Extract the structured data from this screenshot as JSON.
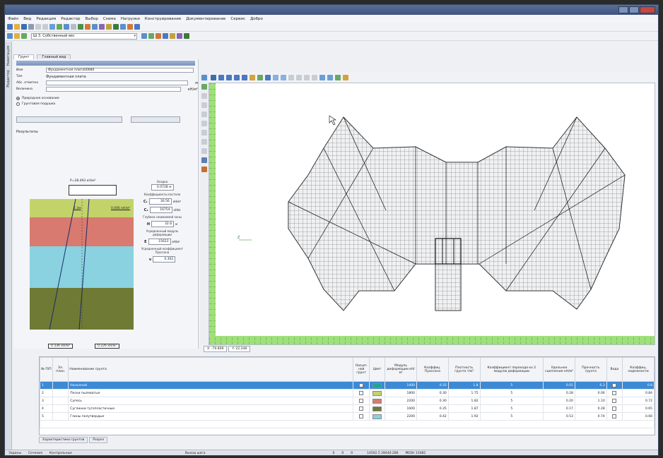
{
  "window": {
    "title": ""
  },
  "menu": [
    "Файл",
    "Вид",
    "Редакция",
    "Редактор",
    "Выбор",
    "Схема",
    "Нагрузки",
    "Конструирование",
    "Документирование",
    "Сервис",
    "Добро"
  ],
  "toolbar": {
    "combo_value": "Ш 3. Собственный вес"
  },
  "left_strip": [
    "Навигация",
    "Редактор"
  ],
  "tabs": [
    "Грунт",
    "Главный вид"
  ],
  "panel": {
    "header": "",
    "name_label": "Имя",
    "name_value": "Фундаментная плита00680",
    "type_label": "Тип",
    "type_value": "Фундаментная плита",
    "abs_label": "Абс. отметка",
    "abs_unit": "м",
    "area_label": "Величина",
    "area_unit": "кН/м²",
    "radio1": "Природное основание",
    "radio2": "Грунтовая подушка",
    "btn_calc": "",
    "btn_param": "",
    "results_label": "Результаты",
    "load_label": "P=28.493 кН/м²",
    "settle_label": "Осадка",
    "settle_value": "0.0728 м",
    "coef_label": "Коэффициенты постели",
    "c1_label": "C₁",
    "c1_value": "30.56",
    "c1_unit": "кН/м³",
    "c2_label": "C₂",
    "c2_value": "16754",
    "c2_unit": "кН/м",
    "depth_label": "Глубина сжимаемой зоны",
    "h_label": "H",
    "h_value": "32.6",
    "h_unit": "м",
    "mod_label": "Усредненный модуль деформации",
    "e_label": "E",
    "e_value": "15623",
    "e_unit": "кН/м²",
    "pois_label": "Усредненный коэффициент Пуассона",
    "v_label": "ν",
    "v_value": "0.302",
    "bottom_left": "0.336 кН/м²",
    "bottom_right": "0.226 кН/м²",
    "mid_left": "2.3м",
    "mid_right": "0.006 кН/м²",
    "soil_layers": [
      {
        "color": "#c3d36a",
        "h": 14
      },
      {
        "color": "#d87a6f",
        "h": 22
      },
      {
        "color": "#8ad2e0",
        "h": 32
      },
      {
        "color": "#6f7a35",
        "h": 32
      }
    ]
  },
  "canvas": {
    "axis_label": "Z"
  },
  "coords": {
    "x": "X: -70.809",
    "y": "Y: 22.248"
  },
  "grid": {
    "headers": [
      "№ П/П",
      "Эл. план.",
      "Наименование грунта",
      "Насып-ной грунт",
      "Цвет",
      "Модуль деформации кН/м²",
      "Коэффиц. Пуассона",
      "Плотность грунта т/м³",
      "Коэффициент перехода ко 2 модулю деформации",
      "Удельное сцепление кН/м²",
      "Прочность грунта",
      "Вода",
      "Коэффиц. надежности"
    ],
    "rows": [
      {
        "n": "1",
        "name": "Насыпной",
        "col": "#22a398",
        "vals": [
          "1400",
          "0.35",
          "1.8",
          "5",
          "0.01",
          "0.3",
          "0.8"
        ],
        "sel": true
      },
      {
        "n": "2",
        "name": "Пески пылеватые",
        "col": "#c3d36a",
        "vals": [
          "1800",
          "0.30",
          "1.75",
          "5",
          "0.28",
          "0.06",
          "0.84"
        ],
        "sel": false
      },
      {
        "n": "3",
        "name": "Супесь",
        "col": "#d87a6f",
        "vals": [
          "2200",
          "0.30",
          "1.82",
          "5",
          "0.20",
          "1.10",
          "0.72"
        ],
        "sel": false
      },
      {
        "n": "4",
        "name": "Суглинки тугопластичные",
        "col": "#6f7a35",
        "vals": [
          "1600",
          "0.35",
          "1.87",
          "5",
          "0.17",
          "0.28",
          "0.65"
        ],
        "sel": false
      },
      {
        "n": "5",
        "name": "Глины полутвердые",
        "col": "#8ad2e0",
        "vals": [
          "2200",
          "0.42",
          "1.92",
          "5",
          "0.53",
          "0.74",
          "0.66"
        ],
        "sel": false
      }
    ]
  },
  "bottom_tabs": [
    "Характеристики грунтов",
    "Разрез"
  ],
  "status": [
    "Заданы",
    "Сечения",
    "Контрольные",
    "Выход шага",
    "0",
    "0",
    "0",
    "14502.5 28440.286",
    "MESH 13482"
  ]
}
